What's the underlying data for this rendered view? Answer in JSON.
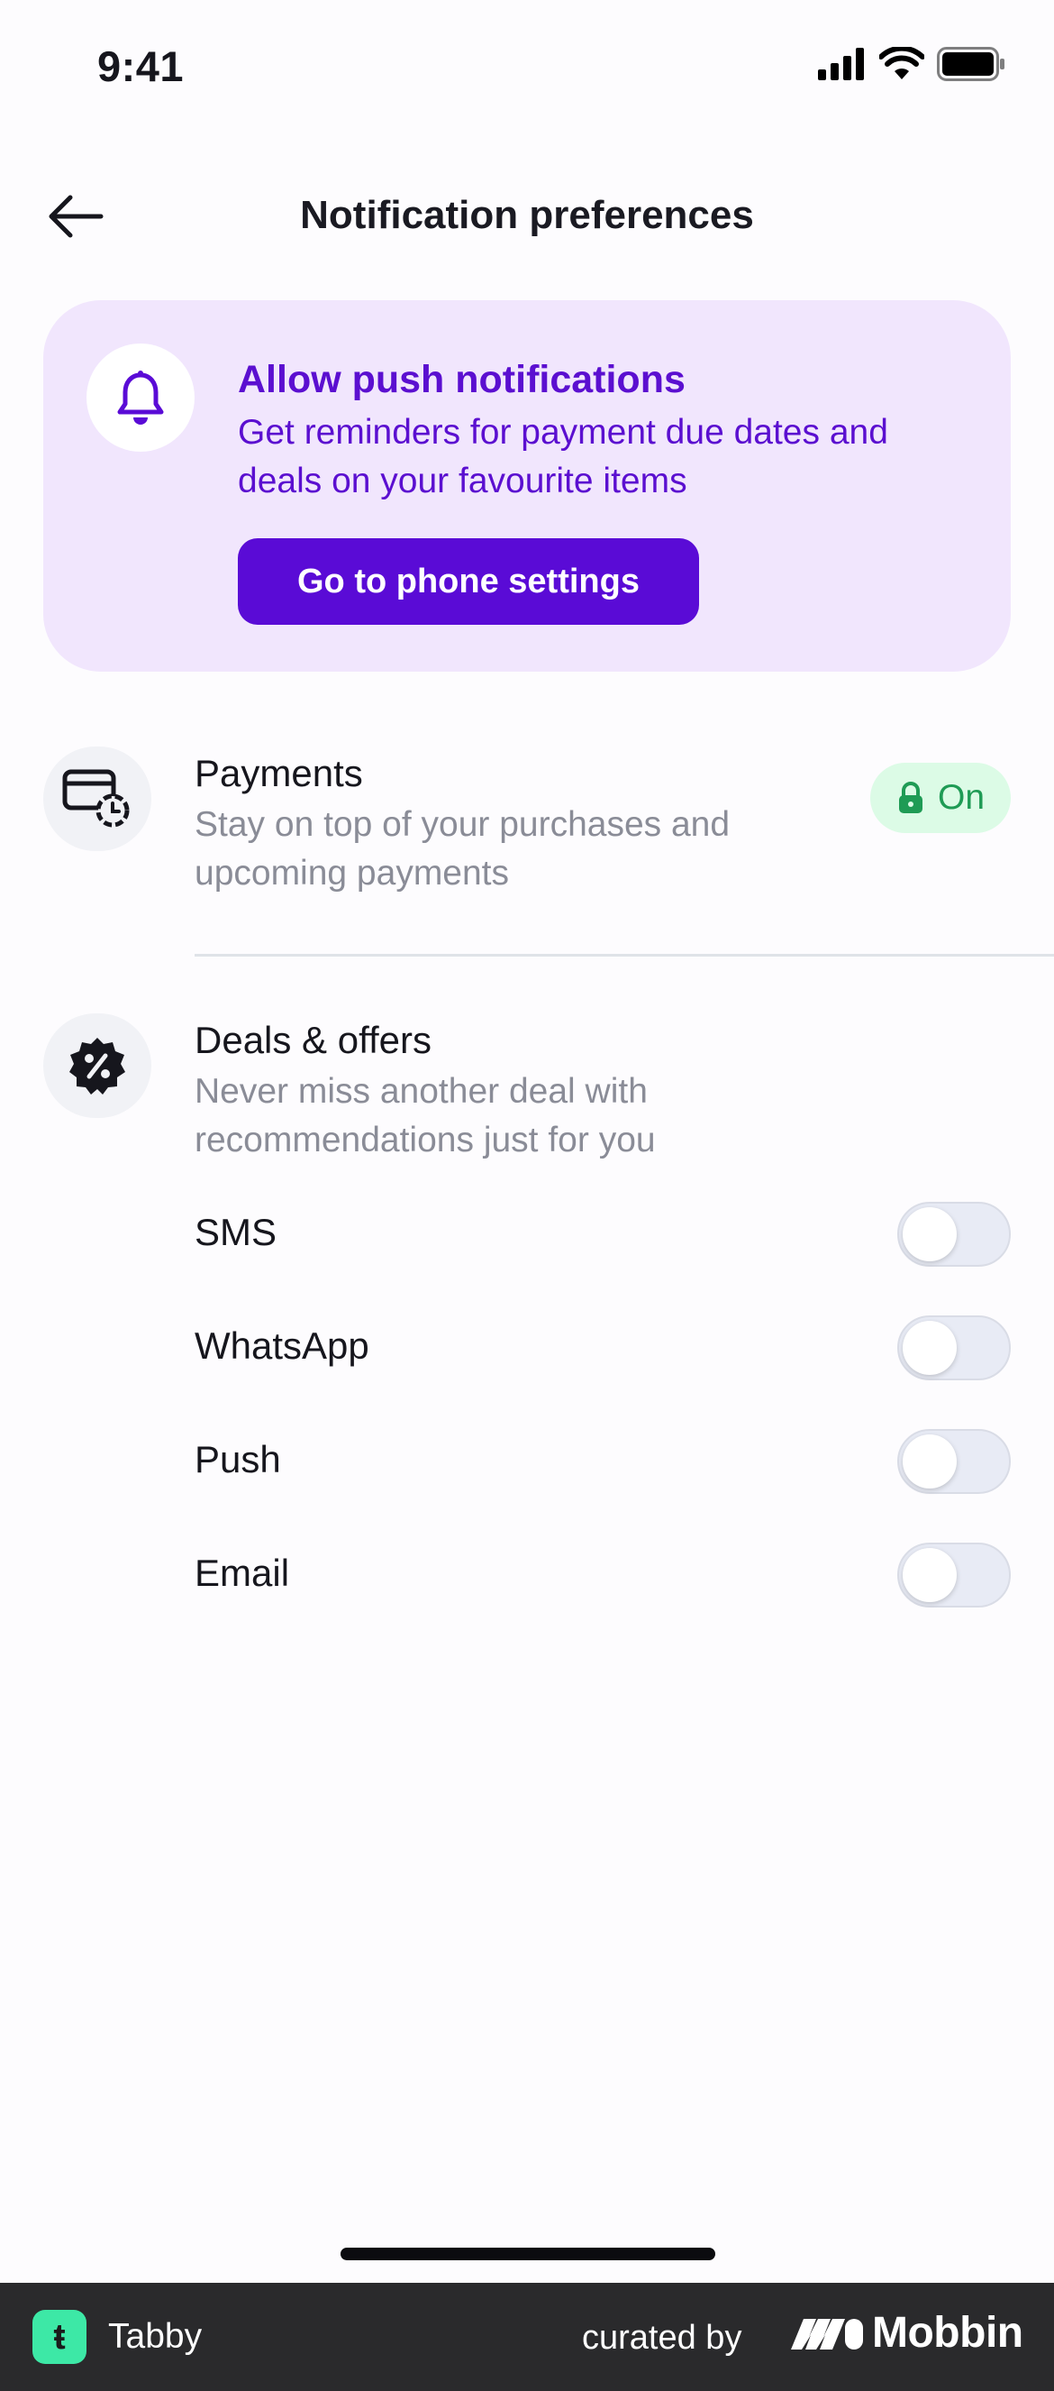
{
  "status_bar": {
    "time": "9:41"
  },
  "header": {
    "title": "Notification preferences"
  },
  "banner": {
    "title": "Allow push notifications",
    "description": "Get reminders for payment due dates and deals on your favourite items",
    "button_label": "Go to phone settings"
  },
  "payments": {
    "title": "Payments",
    "description": "Stay on top of your purchases and upcoming payments",
    "status": "On"
  },
  "deals": {
    "title": "Deals & offers",
    "description": "Never miss another deal with recommendations just for you",
    "channels": [
      {
        "label": "SMS",
        "enabled": false
      },
      {
        "label": "WhatsApp",
        "enabled": false
      },
      {
        "label": "Push",
        "enabled": false
      },
      {
        "label": "Email",
        "enabled": false
      }
    ]
  },
  "footer": {
    "logo_glyph": "ŧ",
    "app_name": "Tabby",
    "curated_by": "curated by",
    "brand": "Mobbin"
  },
  "colors": {
    "accent": "#5a0bd6",
    "banner_bg": "#f1e6fd",
    "success": "#1f9b55",
    "success_bg": "#dcfbe6",
    "logo": "#3de8a6"
  }
}
